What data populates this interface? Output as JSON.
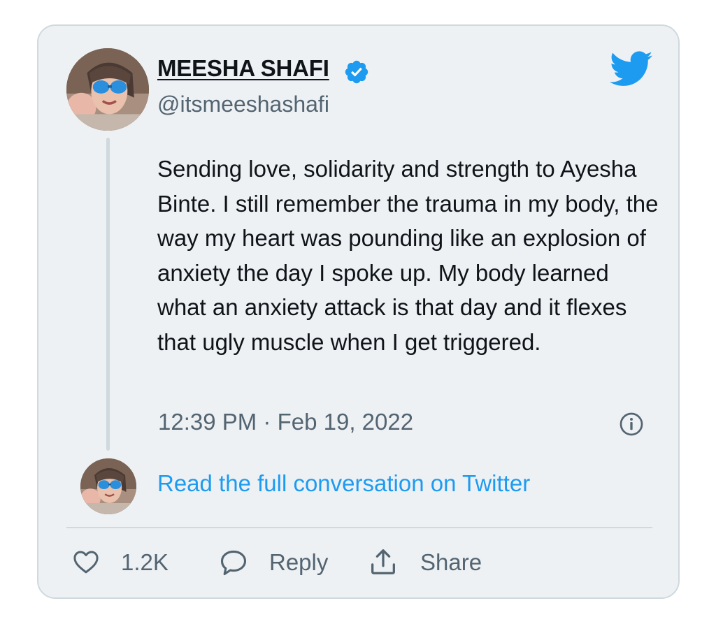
{
  "tweet": {
    "author_name": "MEESHA SHAFI",
    "author_handle": "@itsmeeshashafi",
    "text": "Sending love, solidarity and strength to Ayesha Binte. I still remember the trauma in my body, the way my heart was pounding like an explosion of anxiety the day I spoke up. My body learned what an anxiety attack is that day and it flexes that ugly muscle when I get triggered.",
    "timestamp": "12:39 PM · Feb 19, 2022",
    "read_full_link": "Read the full conversation on Twitter"
  },
  "actions": {
    "like_count": "1.2K",
    "reply_label": "Reply",
    "share_label": "Share"
  },
  "icons": {
    "brand": "twitter-bird-icon",
    "verified": "verified-badge-icon",
    "info": "info-icon",
    "like": "heart-icon",
    "reply": "speech-bubble-icon",
    "share": "share-arrow-icon"
  },
  "colors": {
    "card_background": "#eef1f4",
    "card_border": "#cfd9de",
    "accent": "#1d9bf0",
    "text_primary": "#0f1419",
    "text_secondary": "#536471"
  }
}
